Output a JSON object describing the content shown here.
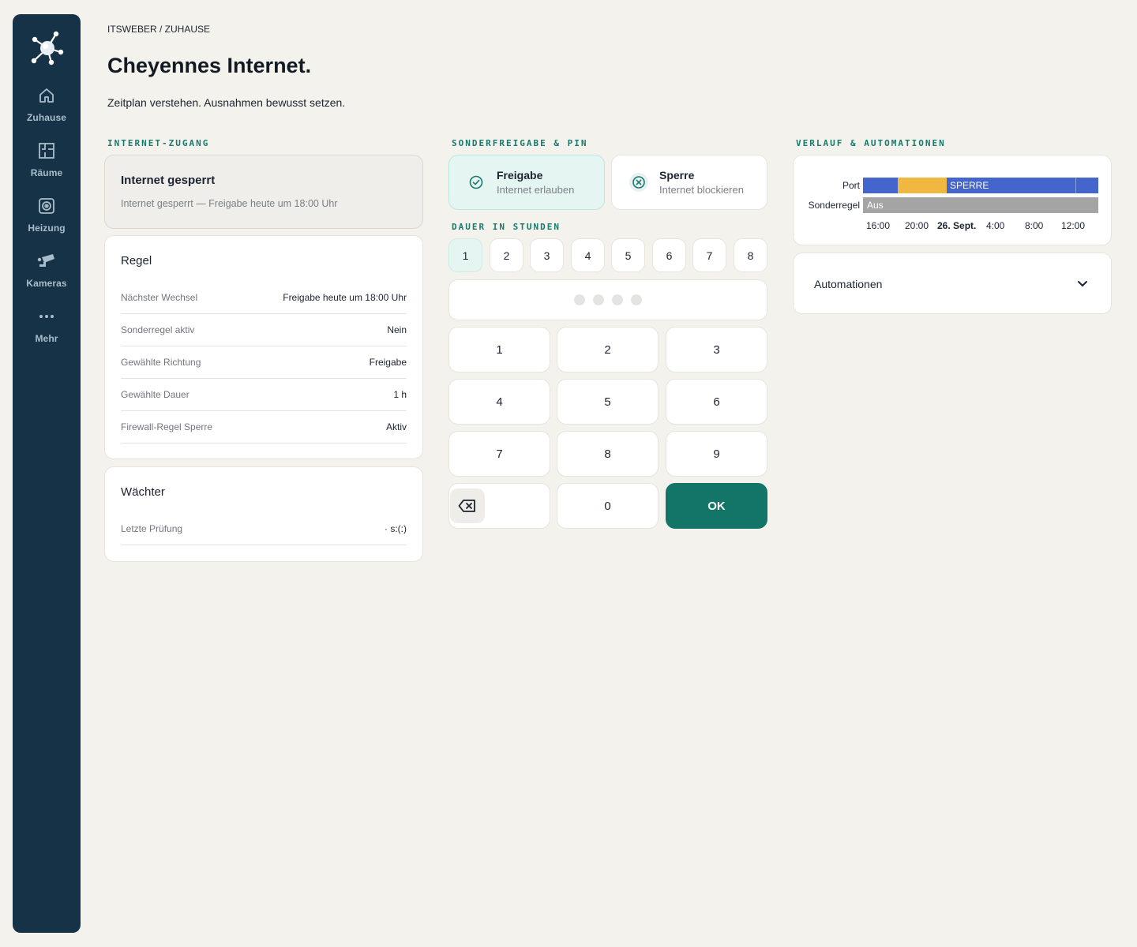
{
  "sidebar": {
    "items": [
      {
        "label": "Zuhause",
        "icon": "home-icon"
      },
      {
        "label": "Räume",
        "icon": "floorplan-icon"
      },
      {
        "label": "Heizung",
        "icon": "heating-icon"
      },
      {
        "label": "Kameras",
        "icon": "camera-icon"
      },
      {
        "label": "Mehr",
        "icon": "more-icon"
      }
    ]
  },
  "header": {
    "breadcrumb": "ITSWEBER / ZUHAUSE",
    "title": "Cheyennes Internet.",
    "subtitle": "Zeitplan verstehen. Ausnahmen bewusst setzen."
  },
  "access": {
    "section_label": "INTERNET-ZUGANG",
    "status_title": "Internet gesperrt",
    "status_text": "Internet gesperrt — Freigabe heute um 18:00 Uhr"
  },
  "rule": {
    "title": "Regel",
    "rows": [
      {
        "key": "Nächster Wechsel",
        "value": "Freigabe heute um 18:00 Uhr"
      },
      {
        "key": "Sonderregel aktiv",
        "value": "Nein"
      },
      {
        "key": "Gewählte Richtung",
        "value": "Freigabe"
      },
      {
        "key": "Gewählte Dauer",
        "value": "1 h"
      },
      {
        "key": "Firewall-Regel Sperre",
        "value": "Aktiv"
      }
    ]
  },
  "watcher": {
    "title": "Wächter",
    "rows": [
      {
        "key": "Letzte Prüfung",
        "value": "· s:(:)"
      }
    ]
  },
  "override": {
    "section_label": "SONDERFREIGABE & PIN",
    "allow": {
      "title": "Freigabe",
      "subtitle": "Internet erlauben"
    },
    "block": {
      "title": "Sperre",
      "subtitle": "Internet blockieren"
    },
    "duration_label": "DAUER IN STUNDEN",
    "hours": [
      "1",
      "2",
      "3",
      "4",
      "5",
      "6",
      "7",
      "8"
    ],
    "selected_hour": "1",
    "pin_length": 4,
    "keys": [
      "1",
      "2",
      "3",
      "4",
      "5",
      "6",
      "7",
      "8",
      "9",
      "0"
    ],
    "ok_label": "OK"
  },
  "history": {
    "section_label": "VERLAUF & AUTOMATIONEN",
    "rows": [
      {
        "label": "Port",
        "segment_text": "SPERRE"
      },
      {
        "label": "Sonderregel",
        "segment_text": "Aus"
      }
    ],
    "ticks": [
      "16:00",
      "20:00",
      "26. Sept.",
      "4:00",
      "8:00",
      "12:00"
    ],
    "colors": {
      "blocked": "#4466cc",
      "allowed": "#f0b840",
      "off": "#a4a4a4"
    }
  },
  "automations": {
    "title": "Automationen"
  }
}
